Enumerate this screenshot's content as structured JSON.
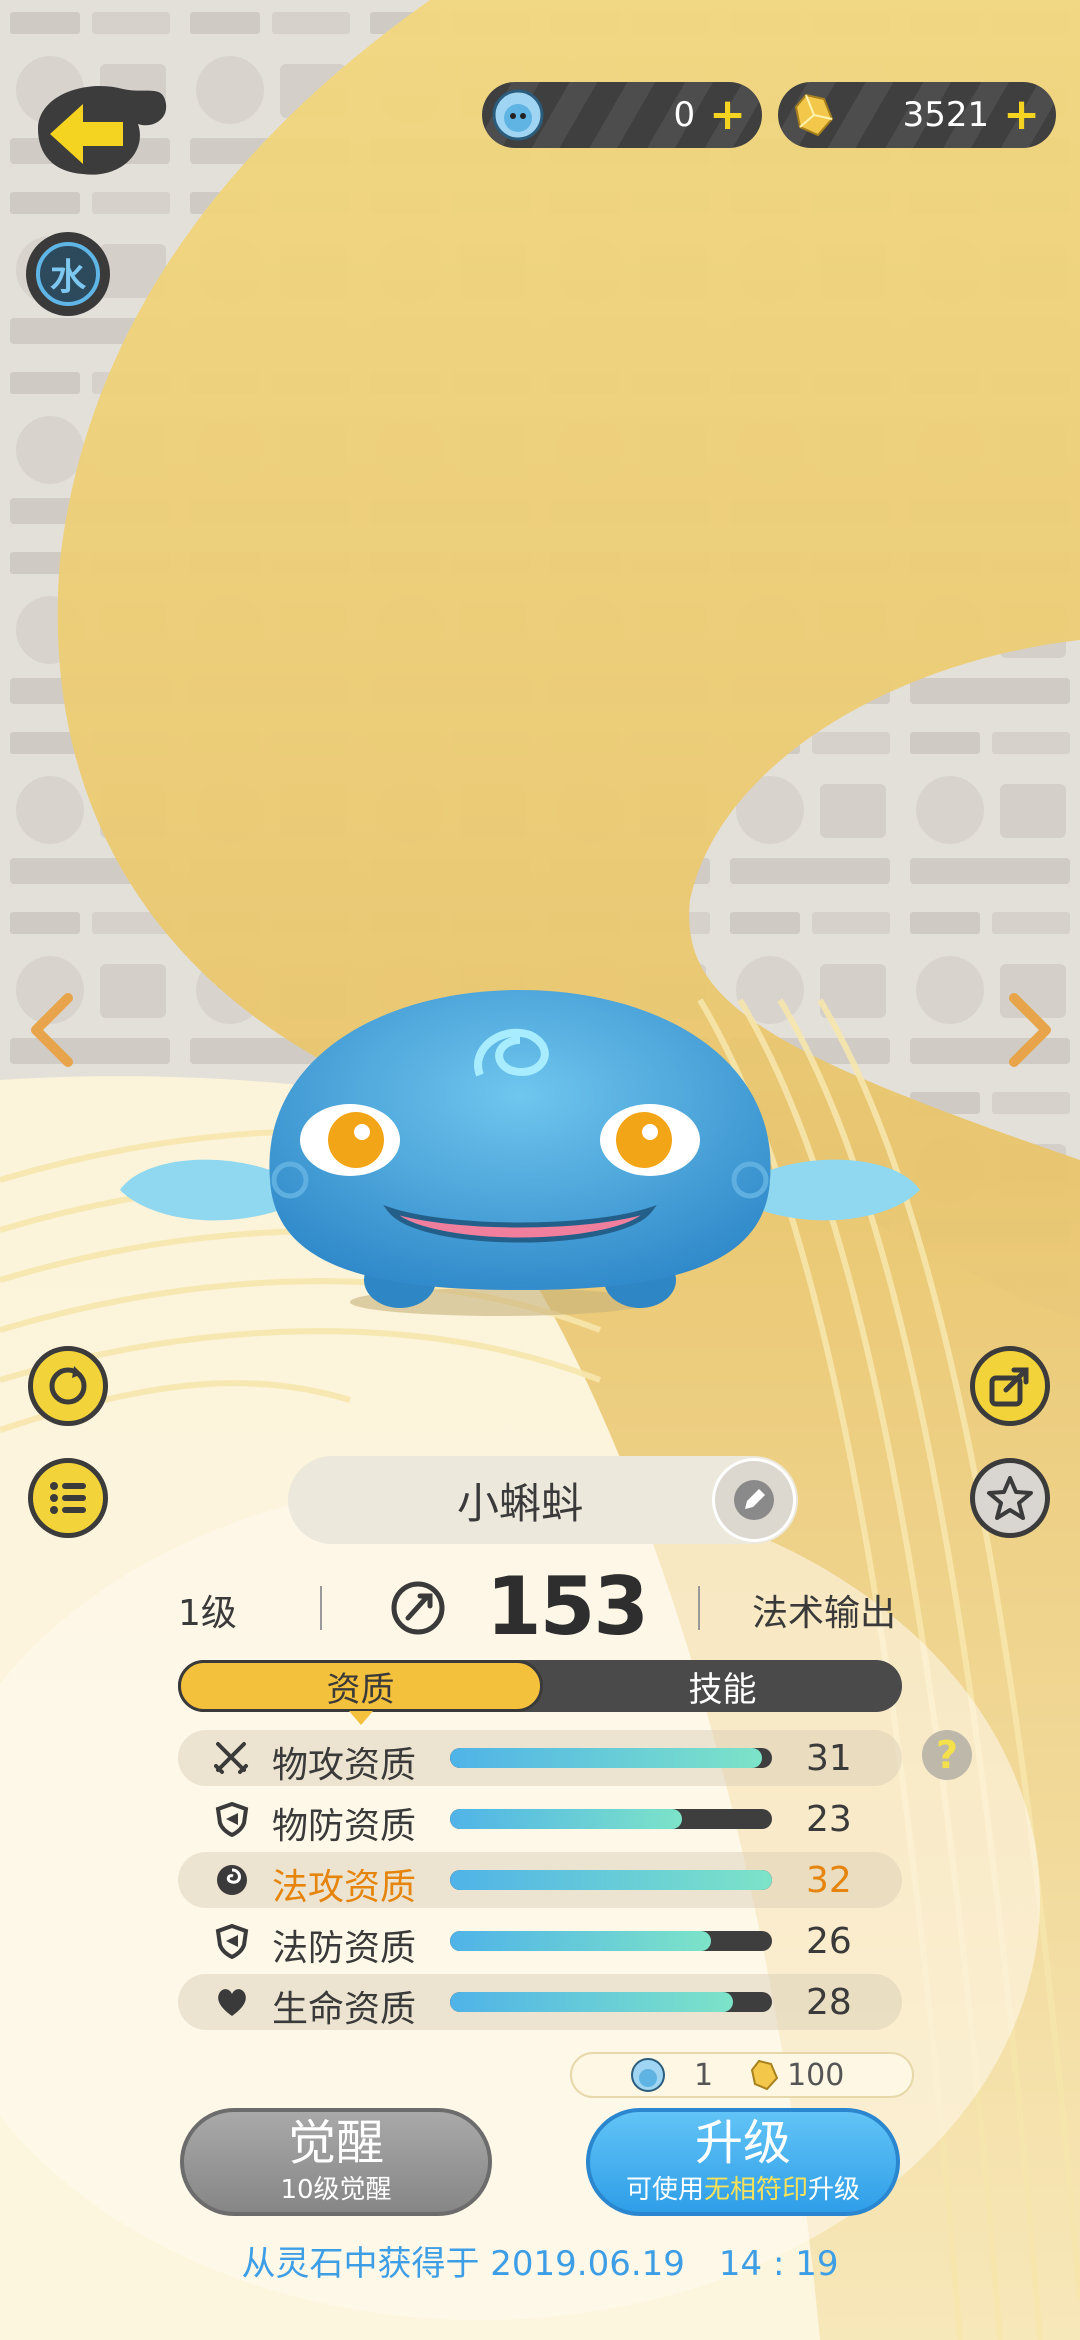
{
  "currency": {
    "gems": {
      "icon": "spirit-orb-icon",
      "value": "0"
    },
    "crystals": {
      "icon": "crystal-icon",
      "value": "3521"
    },
    "plus": "+"
  },
  "element_badge": "水",
  "pet": {
    "name": "小蝌蚪"
  },
  "stats_header": {
    "level": "1级",
    "power": "153",
    "role": "法术输出"
  },
  "tabs": [
    {
      "label": "资质",
      "active": true
    },
    {
      "label": "技能",
      "active": false
    }
  ],
  "attributes": [
    {
      "icon": "swords-icon",
      "label": "物攻资质",
      "value": "31",
      "fill": 0.97,
      "highlight": false,
      "shaded": true
    },
    {
      "icon": "shield-icon",
      "label": "物防资质",
      "value": "23",
      "fill": 0.72,
      "highlight": false,
      "shaded": false
    },
    {
      "icon": "magic-swirl-icon",
      "label": "法攻资质",
      "value": "32",
      "fill": 1.0,
      "highlight": true,
      "shaded": true
    },
    {
      "icon": "shield-icon",
      "label": "法防资质",
      "value": "26",
      "fill": 0.81,
      "highlight": false,
      "shaded": false
    },
    {
      "icon": "heart-icon",
      "label": "生命资质",
      "value": "28",
      "fill": 0.88,
      "highlight": false,
      "shaded": true
    }
  ],
  "help": "?",
  "cost": {
    "orb_amount": "1",
    "crystal_amount": "100"
  },
  "awaken_button": {
    "label": "觉醒",
    "sub": "10级觉醒"
  },
  "upgrade_button": {
    "label": "升级",
    "sub_prefix": "可使用",
    "sub_highlight": "无相符印",
    "sub_suffix": "升级"
  },
  "source": "从灵石中获得于 2019.06.19　14 : 19",
  "colors": {
    "accent_yellow": "#f4c13c",
    "highlight_orange": "#e5850d",
    "blue": "#3d9ee6"
  }
}
